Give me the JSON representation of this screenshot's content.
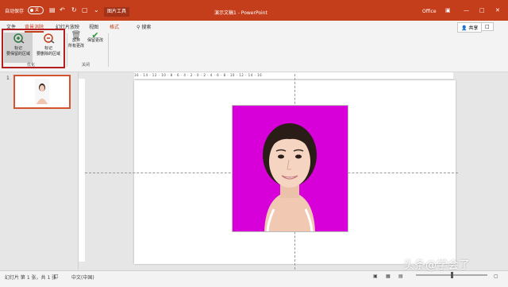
{
  "titlebar": {
    "autosave_label": "自动保存",
    "autosave_state": "关",
    "context_tools": "图片工具",
    "doc_title": "演示文稿1  -  PowerPoint",
    "account": "Office",
    "icons": [
      "save-icon",
      "undo-icon",
      "redo-icon",
      "present-icon",
      "more-icon",
      "ribbon-display-icon",
      "minimize-icon",
      "maximize-icon",
      "close-icon"
    ],
    "accent": "#c43e1c"
  },
  "ribbon": {
    "tabs": [
      "文件",
      "背景消除",
      "幻灯片放映",
      "视图",
      "格式"
    ],
    "active_tab": "背景消除",
    "search": "搜索",
    "share": "共享",
    "groups": {
      "refine": {
        "label": "优化",
        "keep_label_1": "标记",
        "keep_label_2": "要保留的区域",
        "remove_label_1": "标记",
        "remove_label_2": "要删除的区域"
      },
      "close": {
        "label": "关闭",
        "discard_label_1": "放弃",
        "discard_label_2": "所有更改",
        "keep_changes_label": "保留更改"
      }
    }
  },
  "thumbnails": [
    {
      "number": "1"
    }
  ],
  "ruler": {
    "h_labels": "16 · 14 · 12 · 10 · 8 · 6 · 4 · 2 · 0 · 2 · 4 · 6 · 8 · 10 · 12 · 14 · 16"
  },
  "photo": {
    "background": "#d800d8",
    "subject": "portrait-photo"
  },
  "status": {
    "slide_info": "幻灯片 第 1 张，共 1 张",
    "language": "中文(中国)"
  },
  "watermark": "头条@学会了"
}
